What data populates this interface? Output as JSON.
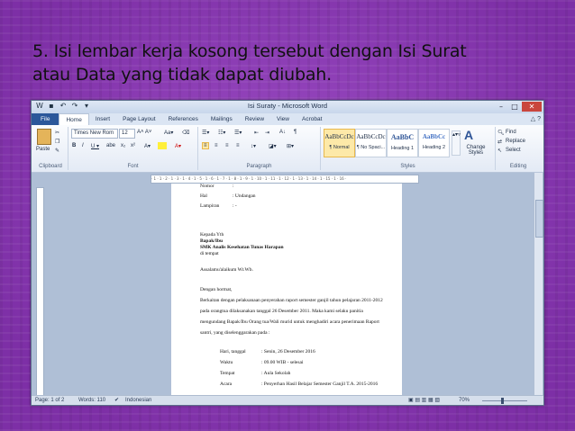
{
  "slide": {
    "title_line1": "5. Isi lembar kerja kosong tersebut dengan Isi Surat",
    "title_line2": "atau  Data yang tidak dapat diubah."
  },
  "window": {
    "title": "Isi Suraty - Microsoft Word"
  },
  "ribbon_tabs": [
    "File",
    "Home",
    "Insert",
    "Page Layout",
    "References",
    "Mailings",
    "Review",
    "View",
    "Acrobat"
  ],
  "ribbon": {
    "clipboard": {
      "paste": "Paste",
      "label": "Clipboard"
    },
    "font": {
      "name": "Times New Rom",
      "size": "12",
      "label": "Font"
    },
    "paragraph": {
      "label": "Paragraph"
    },
    "styles": {
      "items": [
        {
          "preview": "AaBbCcDc",
          "name": "¶ Normal"
        },
        {
          "preview": "AaBbCcDc",
          "name": "¶ No Spaci..."
        },
        {
          "preview": "AaBbC",
          "name": "Heading 1"
        },
        {
          "preview": "AaBbCc",
          "name": "Heading 2"
        }
      ],
      "change": "Change Styles",
      "label": "Styles"
    },
    "editing": {
      "find": "Find",
      "replace": "Replace",
      "select": "Select",
      "label": "Editing"
    }
  },
  "document": {
    "nomor_label": "Nomor",
    "nomor_sep": ":",
    "hal_label": "Hal",
    "hal_value": ": Undangan",
    "lampiran_label": "Lampiran",
    "lampiran_value": ": -",
    "kepada": "Kepada Yth",
    "recipient1": "Bapak/Ibu",
    "recipient2": "SMK Analis Kesehatan Tunas Harapan",
    "recipient3": "di tempat",
    "salam": "Assalamu'alaikum Wr.Wb.",
    "hormat": "Dengan hormat,",
    "body1": "Berkaitan dengan pelaksanaan penyerahan raport semester ganjil tahun pelajaran 2011-2012",
    "body2": "pada orangtua dilaksanakan tanggal 26 Desember 2011. Maka kami selaku panitia",
    "body3": "mengundang Bapak/Ibu Orang tua/Wali murid untuk menghadiri acara penerimaan Raport",
    "body4": "santri, yang diselenggarakan pada :",
    "details": [
      {
        "label": "Hari, tanggal",
        "value": ":  Senin, 26 Desember 2016"
      },
      {
        "label": "Waktu",
        "value": ":  09.00 WIB - selesai"
      },
      {
        "label": "Tempat",
        "value": ":  Aula Sekolah"
      },
      {
        "label": "Acara",
        "value": ":  Penyerhan Hasil Belajar Semester Ganjil T.A. 2015-2016"
      }
    ]
  },
  "status": {
    "page": "Page: 1 of 2",
    "words": "Words: 110",
    "language": "Indonesian",
    "zoom": "70%"
  }
}
